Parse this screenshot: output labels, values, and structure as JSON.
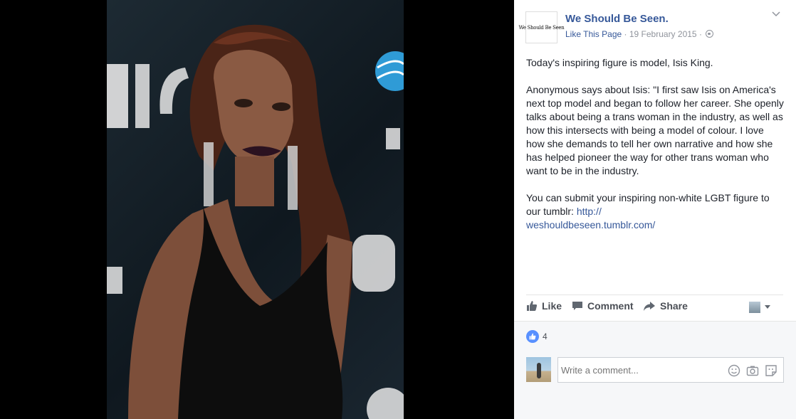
{
  "post": {
    "page_name": "We Should Be Seen.",
    "page_logo_text": "We Should Be Seen",
    "like_page_label": "Like This Page",
    "separator": "·",
    "date": "19 February 2015",
    "paragraphs": [
      "Today's inspiring figure is model, Isis King.",
      "Anonymous says about Isis: \"I first saw Isis on America's next top model and began to follow her career. She openly talks about being a trans woman in the industry, as well as how this intersects with being a model of colour. I love how she demands to tell her own narrative and how she has helped pioneer the way for other trans woman who want to be in the industry."
    ],
    "submit_text": "You can submit your inspiring non-white LGBT figure to our tumblr: ",
    "link_text": "http://\nweshouldbeseen.tumblr.com/",
    "privacy_icon": "globe-icon",
    "menu_icon": "chevron-down-icon"
  },
  "actions": {
    "like_label": "Like",
    "comment_label": "Comment",
    "share_label": "Share"
  },
  "reactions": {
    "like_count": "4",
    "accent_color": "#5890ff"
  },
  "comment": {
    "placeholder": "Write a comment..."
  },
  "colors": {
    "link": "#365899",
    "text": "#1d2129",
    "meta": "#90949c"
  }
}
